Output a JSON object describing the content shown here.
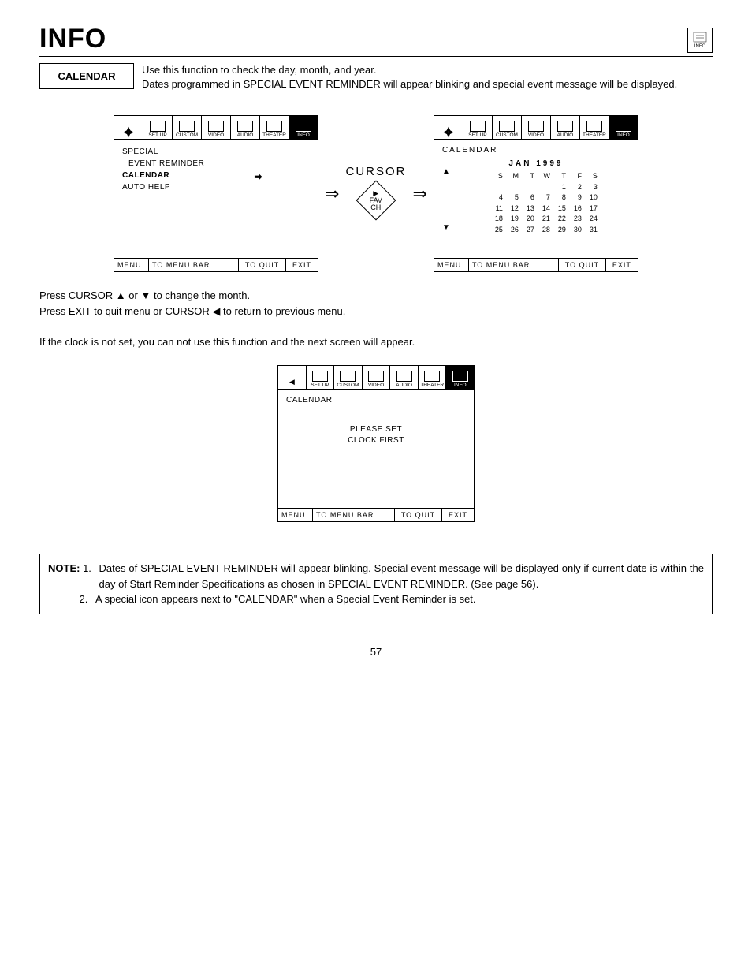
{
  "header": {
    "title": "INFO",
    "icon_label": "INFO"
  },
  "section": {
    "label": "CALENDAR",
    "description": "Use this function to check the day, month, and year.\nDates programmed in SPECIAL EVENT REMINDER will appear blinking and special event message will be displayed."
  },
  "tabs": [
    "SET UP",
    "CUSTOM",
    "VIDEO",
    "AUDIO",
    "THEATER",
    "INFO"
  ],
  "screen1": {
    "menu_items": [
      {
        "text": "SPECIAL",
        "bold": false
      },
      {
        "text": "EVENT REMINDER",
        "bold": false,
        "indent": true
      },
      {
        "text": "CALENDAR",
        "bold": true,
        "selected": true
      },
      {
        "text": "AUTO HELP",
        "bold": false
      }
    ],
    "footer": {
      "menu": "MENU",
      "bar": "TO MENU BAR",
      "quit": "TO QUIT",
      "exit": "EXIT"
    }
  },
  "cursor_label": "CURSOR",
  "fav_ch": "FAV\nCH",
  "screen2": {
    "title": "CALENDAR",
    "month": "JAN 1999",
    "days": [
      "S",
      "M",
      "T",
      "W",
      "T",
      "F",
      "S"
    ],
    "weeks": [
      [
        "",
        "",
        "",
        "",
        "",
        "1",
        "2",
        "3"
      ],
      [
        "",
        "4",
        "5",
        "6",
        "7",
        "8",
        "9",
        "10"
      ],
      [
        "",
        "11",
        "12",
        "13",
        "14",
        "15",
        "16",
        "17"
      ],
      [
        "",
        "18",
        "19",
        "20",
        "21",
        "22",
        "23",
        "24"
      ],
      [
        "",
        "25",
        "26",
        "27",
        "28",
        "29",
        "30",
        "31"
      ]
    ],
    "footer": {
      "menu": "MENU",
      "bar": "TO MENU BAR",
      "quit": "TO QUIT",
      "exit": "EXIT"
    }
  },
  "instructions": {
    "line1_a": "Press CURSOR ",
    "line1_b": " or ",
    "line1_c": " to change the month.",
    "line2_a": "Press EXIT to quit menu or CURSOR ",
    "line2_b": " to return to previous menu.",
    "line3": "If the clock is not set, you can not use this function and the next screen will appear."
  },
  "screen3": {
    "title": "CALENDAR",
    "msg1": "PLEASE SET",
    "msg2": "CLOCK FIRST",
    "footer": {
      "menu": "MENU",
      "bar": "TO MENU BAR",
      "quit": "TO QUIT",
      "exit": "EXIT"
    }
  },
  "note": {
    "label": "NOTE:",
    "items": [
      "Dates of SPECIAL EVENT REMINDER will appear blinking.  Special event message will be displayed only if current date is within the day of Start Reminder Specifications as chosen in SPECIAL EVENT REMINDER. (See page 56).",
      "A special icon appears next to \"CALENDAR\" when a Special Event Reminder is set."
    ]
  },
  "page_number": "57"
}
